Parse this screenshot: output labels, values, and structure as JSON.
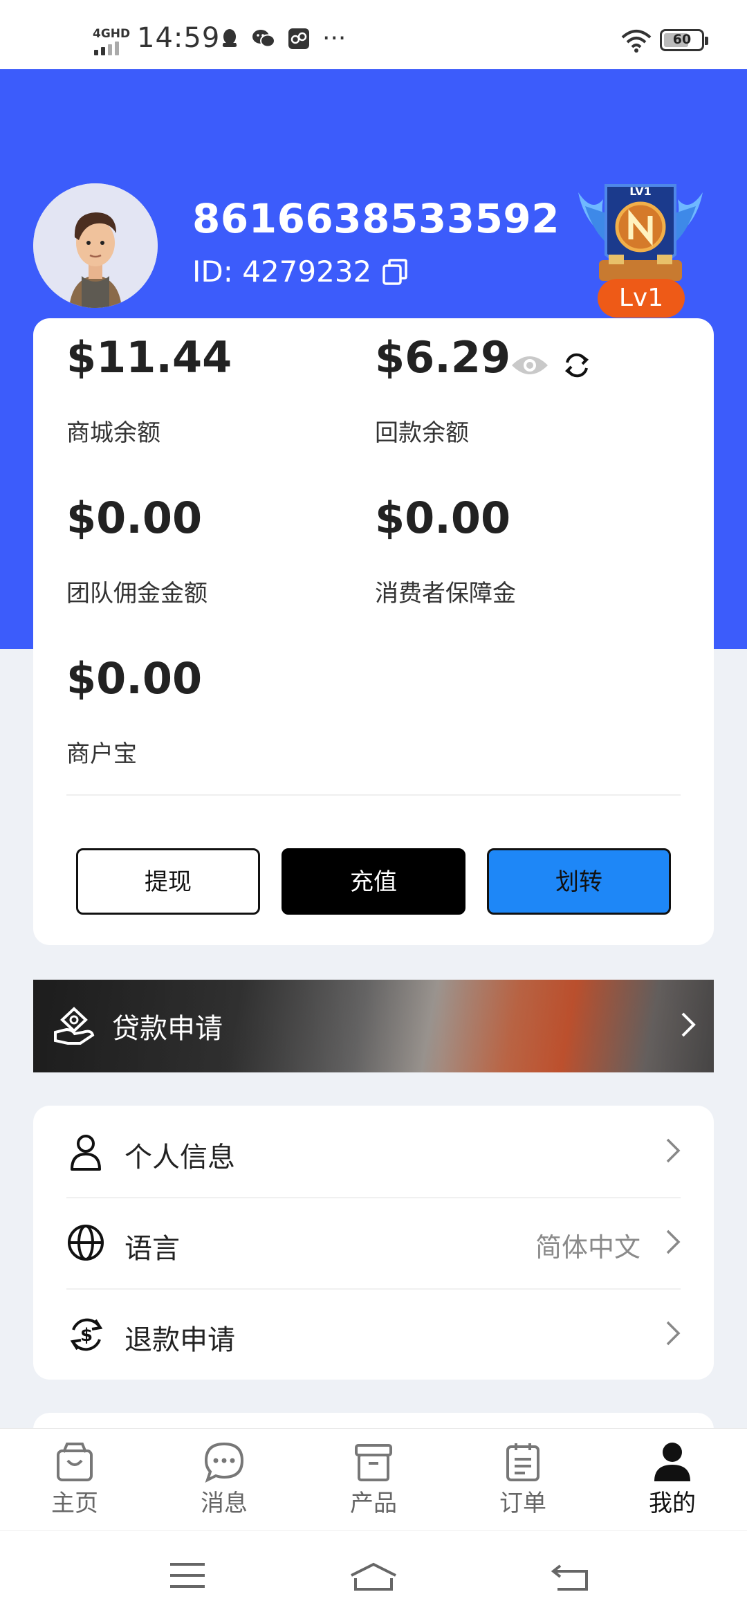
{
  "status_bar": {
    "network": "4GHD",
    "time": "14:59",
    "notification_icons": [
      "qq-icon",
      "wechat-icon",
      "game-icon"
    ],
    "more": "···",
    "battery": "60"
  },
  "profile": {
    "phone": "8616638533592",
    "id_text": "ID: 4279232",
    "level": "Lv1",
    "badge_text": "LV1"
  },
  "balances": {
    "mall_amount": "$11.44",
    "mall_label": "商城余额",
    "refund_amount": "$6.29",
    "refund_label": "回款余额",
    "team_amount": "$0.00",
    "team_label": "团队佣金金额",
    "guarantee_amount": "$0.00",
    "guarantee_label": "消费者保障金",
    "merchant_amount": "$0.00",
    "merchant_label": "商户宝"
  },
  "actions": {
    "withdraw": "提现",
    "recharge": "充值",
    "transfer": "划转"
  },
  "loan_banner": {
    "label": "贷款申请"
  },
  "menu": {
    "personal_info": "个人信息",
    "language": "语言",
    "language_value": "简体中文",
    "refund_request": "退款申请"
  },
  "tabs": [
    {
      "label": "主页",
      "icon": "bag-icon",
      "active": false
    },
    {
      "label": "消息",
      "icon": "chat-icon",
      "active": false
    },
    {
      "label": "产品",
      "icon": "archive-icon",
      "active": false
    },
    {
      "label": "订单",
      "icon": "clipboard-icon",
      "active": false
    },
    {
      "label": "我的",
      "icon": "user-icon",
      "active": true
    }
  ],
  "colors": {
    "header_blue": "#3c5cfb",
    "transfer_button": "#1e87f7",
    "level_badge": "#ee5a17"
  }
}
